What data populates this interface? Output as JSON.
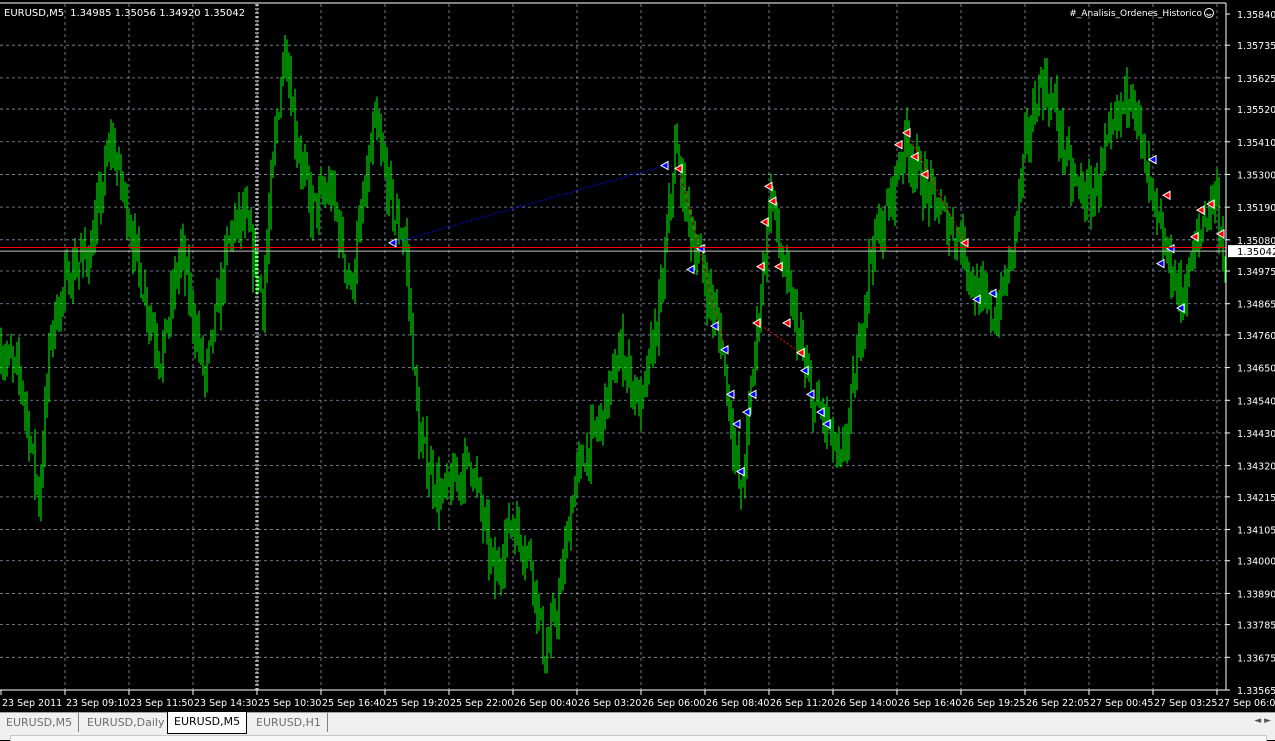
{
  "header": {
    "symbol": "EURUSD,M5",
    "ohlc": "1.34985 1.35056 1.34920 1.35042",
    "indicator": "#_Analisis_Ordenes_Historico",
    "indicator_icon": "smiley-icon"
  },
  "tabs": [
    {
      "label": "EURUSD,M5"
    },
    {
      "label": "EURUSD,Daily"
    },
    {
      "label": "EURUSD,M5",
      "active": true
    },
    {
      "label": "EURUSD,H1"
    }
  ],
  "colors": {
    "bars": "#00ff00",
    "grid": "#8a96a8",
    "bid": "#c0c0c0",
    "ask": "#ff0000",
    "buy": "#0000ff",
    "sell": "#ff0000"
  },
  "chart_data": {
    "type": "bar",
    "title": "EURUSD,M5",
    "ylim": [
      1.33565,
      1.3584
    ],
    "y_ticks": [
      "1.35840",
      "1.35735",
      "1.35625",
      "1.35520",
      "1.35410",
      "1.35300",
      "1.35190",
      "1.35080",
      "1.34975",
      "1.34865",
      "1.34760",
      "1.34650",
      "1.34540",
      "1.34430",
      "1.34320",
      "1.34215",
      "1.34105",
      "1.34000",
      "1.33890",
      "1.33785",
      "1.33675",
      "1.33565"
    ],
    "current_price": "1.35042",
    "ask_price": 1.35054,
    "x_ticks": [
      "23 Sep 2011",
      "23 Sep 09:10",
      "23 Sep 11:50",
      "23 Sep 14:30",
      "25 Sep 10:30",
      "25 Sep 16:40",
      "25 Sep 19:20",
      "25 Sep 22:00",
      "26 Sep 00:40",
      "26 Sep 03:20",
      "26 Sep 06:00",
      "26 Sep 08:40",
      "26 Sep 11:20",
      "26 Sep 14:00",
      "26 Sep 16:40",
      "26 Sep 19:25",
      "26 Sep 22:05",
      "27 Sep 00:45",
      "27 Sep 03:25",
      "27 Sep 06:05"
    ],
    "bar_count": 613,
    "bars_per_tick": 32,
    "session_break_bar": 128,
    "price_path": [
      [
        0,
        1.34711
      ],
      [
        10,
        1.3461
      ],
      [
        19,
        1.34207
      ],
      [
        25,
        1.34778
      ],
      [
        35,
        1.3498
      ],
      [
        45,
        1.35047
      ],
      [
        55,
        1.35417
      ],
      [
        62,
        1.35215
      ],
      [
        70,
        1.34946
      ],
      [
        80,
        1.34677
      ],
      [
        90,
        1.35047
      ],
      [
        102,
        1.3461
      ],
      [
        115,
        1.35114
      ],
      [
        122,
        1.35148
      ],
      [
        131,
        1.34879
      ],
      [
        137,
        1.35417
      ],
      [
        142,
        1.35753
      ],
      [
        147,
        1.3545
      ],
      [
        155,
        1.35181
      ],
      [
        165,
        1.35249
      ],
      [
        175,
        1.34913
      ],
      [
        187,
        1.35467
      ],
      [
        197,
        1.35148
      ],
      [
        202,
        1.35081
      ],
      [
        209,
        1.34409
      ],
      [
        220,
        1.34207
      ],
      [
        235,
        1.34341
      ],
      [
        247,
        1.33938
      ],
      [
        255,
        1.3414
      ],
      [
        265,
        1.34005
      ],
      [
        272,
        1.33669
      ],
      [
        279,
        1.33871
      ],
      [
        287,
        1.34274
      ],
      [
        300,
        1.34476
      ],
      [
        310,
        1.34711
      ],
      [
        320,
        1.34509
      ],
      [
        330,
        1.34879
      ],
      [
        337,
        1.35383
      ],
      [
        345,
        1.35114
      ],
      [
        352,
        1.34946
      ],
      [
        360,
        1.34745
      ],
      [
        370,
        1.34207
      ],
      [
        377,
        1.34711
      ],
      [
        385,
        1.35249
      ],
      [
        390,
        1.35013
      ],
      [
        397,
        1.34812
      ],
      [
        405,
        1.34543
      ],
      [
        412,
        1.34476
      ],
      [
        420,
        1.34308
      ],
      [
        427,
        1.3461
      ],
      [
        435,
        1.35047
      ],
      [
        442,
        1.35148
      ],
      [
        452,
        1.35417
      ],
      [
        460,
        1.35282
      ],
      [
        472,
        1.35148
      ],
      [
        480,
        1.35081
      ],
      [
        487,
        1.34913
      ],
      [
        497,
        1.34812
      ],
      [
        505,
        1.35013
      ],
      [
        512,
        1.35383
      ],
      [
        520,
        1.35618
      ],
      [
        527,
        1.35517
      ],
      [
        535,
        1.35282
      ],
      [
        545,
        1.35215
      ],
      [
        555,
        1.35417
      ],
      [
        565,
        1.35618
      ],
      [
        572,
        1.35316
      ],
      [
        580,
        1.35081
      ],
      [
        590,
        1.34879
      ],
      [
        600,
        1.35114
      ],
      [
        607,
        1.35249
      ],
      [
        613,
        1.34946
      ]
    ],
    "orders": [
      [
        196,
        1.3507,
        "buy"
      ],
      [
        332,
        1.3533,
        "buy"
      ],
      [
        339,
        1.3532,
        "sell"
      ],
      [
        345,
        1.3498,
        "buy"
      ],
      [
        350,
        1.3505,
        "buy"
      ],
      [
        357,
        1.3479,
        "buy"
      ],
      [
        362,
        1.3471,
        "buy"
      ],
      [
        365,
        1.3456,
        "buy"
      ],
      [
        368,
        1.3446,
        "buy"
      ],
      [
        370,
        1.343,
        "buy"
      ],
      [
        373,
        1.345,
        "buy"
      ],
      [
        376,
        1.3456,
        "buy"
      ],
      [
        378,
        1.348,
        "sell"
      ],
      [
        380,
        1.3499,
        "sell"
      ],
      [
        382,
        1.3514,
        "sell"
      ],
      [
        384,
        1.3526,
        "sell"
      ],
      [
        386,
        1.3521,
        "sell"
      ],
      [
        389,
        1.3499,
        "sell"
      ],
      [
        393,
        1.348,
        "sell"
      ],
      [
        400,
        1.347,
        "sell"
      ],
      [
        402,
        1.3464,
        "buy"
      ],
      [
        405,
        1.3456,
        "buy"
      ],
      [
        410,
        1.345,
        "buy"
      ],
      [
        413,
        1.3446,
        "buy"
      ],
      [
        449,
        1.354,
        "sell"
      ],
      [
        453,
        1.3544,
        "sell"
      ],
      [
        457,
        1.3536,
        "sell"
      ],
      [
        462,
        1.353,
        "sell"
      ],
      [
        482,
        1.3507,
        "sell"
      ],
      [
        488,
        1.3488,
        "buy"
      ],
      [
        496,
        1.349,
        "buy"
      ],
      [
        576,
        1.3535,
        "buy"
      ],
      [
        583,
        1.3523,
        "sell"
      ],
      [
        580,
        1.35,
        "buy"
      ],
      [
        585,
        1.3505,
        "buy"
      ],
      [
        590,
        1.3485,
        "buy"
      ],
      [
        597,
        1.3509,
        "sell"
      ],
      [
        600,
        1.3518,
        "sell"
      ],
      [
        605,
        1.352,
        "sell"
      ],
      [
        610,
        1.351,
        "sell"
      ]
    ],
    "order_lines": [
      [
        196,
        1.3507,
        332,
        1.3533,
        "buy"
      ],
      [
        339,
        1.3532,
        362,
        1.3471,
        "sell"
      ],
      [
        378,
        1.348,
        400,
        1.347,
        "sell"
      ],
      [
        453,
        1.3544,
        482,
        1.3507,
        "sell"
      ]
    ]
  }
}
